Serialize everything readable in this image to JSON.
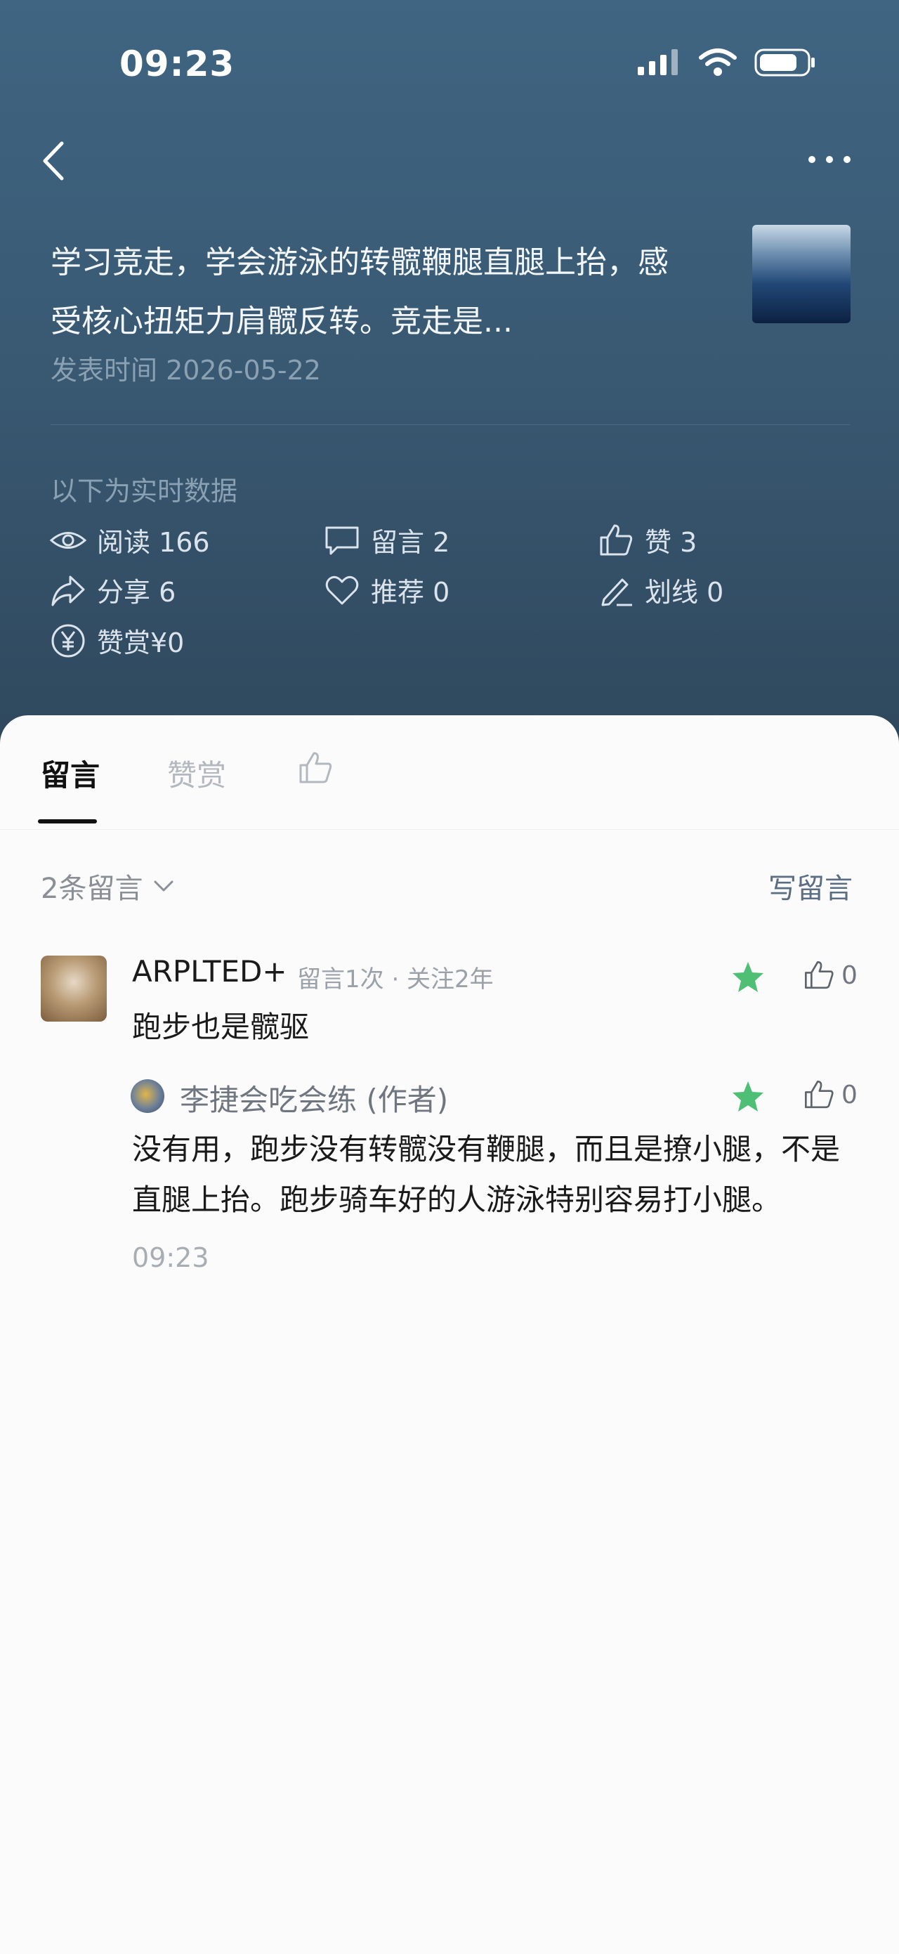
{
  "status": {
    "time": "09:23"
  },
  "article": {
    "title": "学习竞走，学会游泳的转髋鞭腿直腿上抬，感受核心扭矩力肩髋反转。竞走是...",
    "date": "发表时间 2026-05-22"
  },
  "realtime_label": "以下为实时数据",
  "stats": {
    "read": "阅读 166",
    "comment": "留言 2",
    "like": "赞 3",
    "share": "分享 6",
    "recommend": "推荐 0",
    "underline": "划线 0",
    "reward": "赞赏¥0"
  },
  "tabs": {
    "comments": "留言",
    "rewards": "赞赏"
  },
  "comments_bar": {
    "count": "2条留言",
    "write": "写留言"
  },
  "comments": [
    {
      "name": "ARPLTED+",
      "meta": "留言1次 · 关注2年",
      "text": "跑步也是髋驱",
      "likes": "0"
    }
  ],
  "reply": {
    "name": "李捷会吃会练 (作者)",
    "text": "没有用，跑步没有转髋没有鞭腿，而且是撩小腿，不是直腿上抬。跑步骑车好的人游泳特别容易打小腿。",
    "time": "09:23",
    "likes": "0"
  },
  "colors": {
    "header": "#3f6582",
    "star": "#4fbf76",
    "accent": "#5a6d83"
  }
}
